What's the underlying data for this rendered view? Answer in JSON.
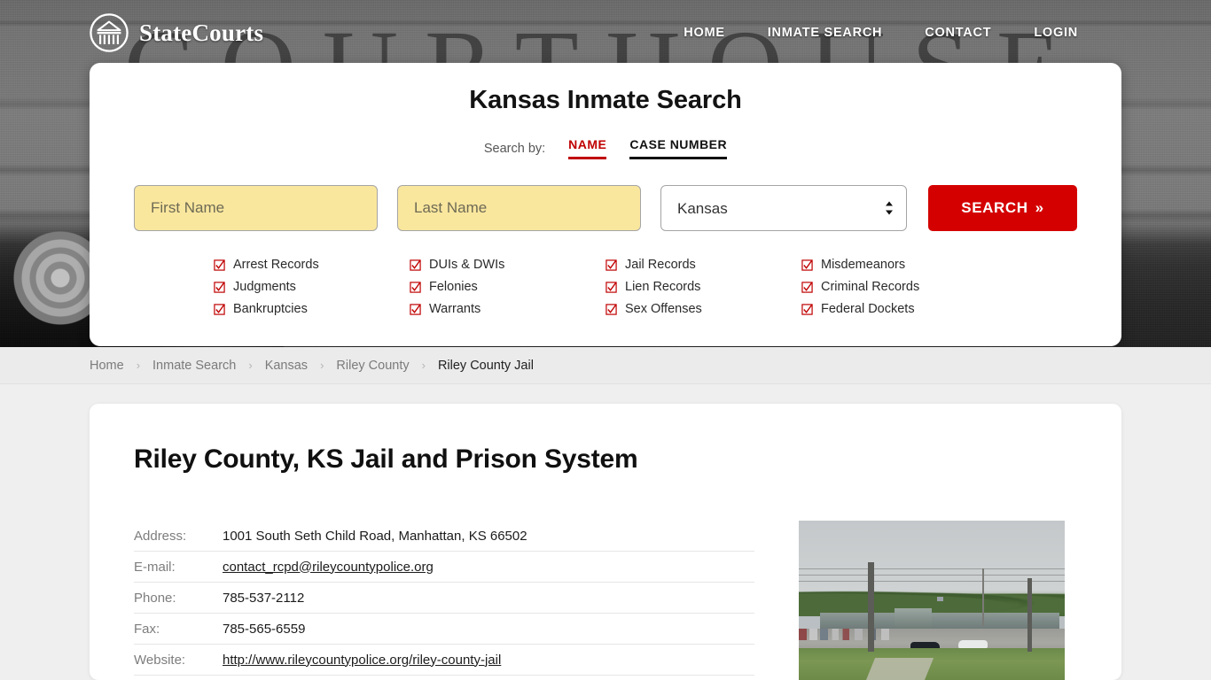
{
  "brand": {
    "name": "StateCourts",
    "logo_icon": "courthouse-circle-icon"
  },
  "nav": {
    "items": [
      {
        "label": "HOME"
      },
      {
        "label": "INMATE SEARCH"
      },
      {
        "label": "CONTACT"
      },
      {
        "label": "LOGIN"
      }
    ]
  },
  "hero": {
    "background_word": "COURTHOUSE"
  },
  "search": {
    "title": "Kansas Inmate Search",
    "search_by_label": "Search by:",
    "tabs": [
      {
        "label": "NAME",
        "active": true
      },
      {
        "label": "CASE NUMBER",
        "active": false
      }
    ],
    "first_name": {
      "value": "",
      "placeholder": "First Name"
    },
    "last_name": {
      "value": "",
      "placeholder": "Last Name"
    },
    "state_select": {
      "value": "Kansas",
      "options": [
        "Kansas"
      ]
    },
    "button_label": "SEARCH",
    "button_chevron": "»",
    "accent_color": "#d40000",
    "field_fill_color": "#fae79e",
    "checkbox_icon": "checked-box-icon",
    "record_types": [
      "Arrest Records",
      "DUIs & DWIs",
      "Jail Records",
      "Misdemeanors",
      "Judgments",
      "Felonies",
      "Lien Records",
      "Criminal Records",
      "Bankruptcies",
      "Warrants",
      "Sex Offenses",
      "Federal Dockets"
    ]
  },
  "breadcrumb": {
    "separator": "›",
    "items": [
      {
        "label": "Home",
        "current": false
      },
      {
        "label": "Inmate Search",
        "current": false
      },
      {
        "label": "Kansas",
        "current": false
      },
      {
        "label": "Riley County",
        "current": false
      },
      {
        "label": "Riley County Jail",
        "current": true
      }
    ]
  },
  "main": {
    "page_title": "Riley County, KS Jail and Prison System",
    "info_rows": [
      {
        "label": "Address:",
        "value": "1001 South Seth Child Road, Manhattan, KS 66502",
        "link": false
      },
      {
        "label": "E-mail:",
        "value": "contact_rcpd@rileycountypolice.org",
        "link": true
      },
      {
        "label": "Phone:",
        "value": "785-537-2112",
        "link": false
      },
      {
        "label": "Fax:",
        "value": "785-565-6559",
        "link": false
      },
      {
        "label": "Website:",
        "value": "http://www.rileycountypolice.org/riley-county-jail",
        "link": true
      }
    ],
    "facility_photo_alt": "riley-county-jail-photo"
  }
}
